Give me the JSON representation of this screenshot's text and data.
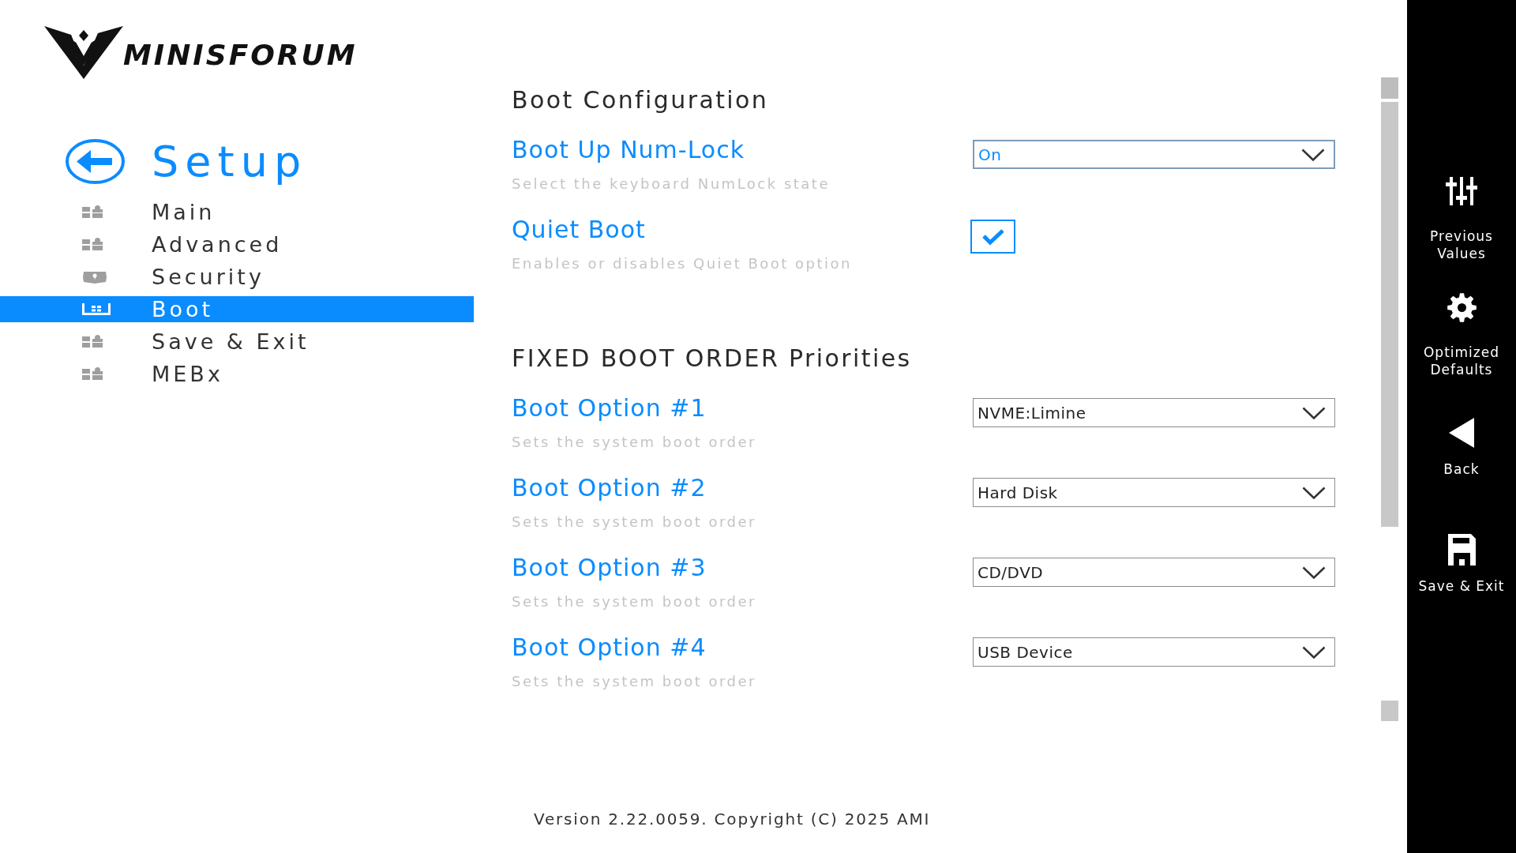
{
  "logo": {
    "text": "MINISFORUM"
  },
  "header": {
    "title": "Setup"
  },
  "sidebar": {
    "items": [
      {
        "label": "Main",
        "selected": false
      },
      {
        "label": "Advanced",
        "selected": false
      },
      {
        "label": "Security",
        "selected": false
      },
      {
        "label": "Boot",
        "selected": true
      },
      {
        "label": "Save & Exit",
        "selected": false
      },
      {
        "label": "MEBx",
        "selected": false
      }
    ]
  },
  "sections": [
    {
      "heading": "Boot Configuration",
      "rows": [
        {
          "kind": "dropdown",
          "label": "Boot Up Num-Lock",
          "description": "Select the keyboard NumLock state",
          "value": "On",
          "focused": true
        },
        {
          "kind": "checkbox",
          "label": "Quiet Boot",
          "description": "Enables or disables Quiet Boot option",
          "checked": true
        }
      ]
    },
    {
      "heading": "FIXED BOOT ORDER Priorities",
      "rows": [
        {
          "kind": "dropdown",
          "label": "Boot Option #1",
          "description": "Sets the system boot order",
          "value": "NVME:Limine",
          "focused": false
        },
        {
          "kind": "dropdown",
          "label": "Boot Option #2",
          "description": "Sets the system boot order",
          "value": "Hard Disk",
          "focused": false
        },
        {
          "kind": "dropdown",
          "label": "Boot Option #3",
          "description": "Sets the system boot order",
          "value": "CD/DVD",
          "focused": false
        },
        {
          "kind": "dropdown",
          "label": "Boot Option #4",
          "description": "Sets the system boot order",
          "value": "USB Device",
          "focused": false
        }
      ]
    }
  ],
  "actions": [
    {
      "label": "Previous Values"
    },
    {
      "label": "Optimized Defaults"
    },
    {
      "label": "Back"
    },
    {
      "label": "Save & Exit"
    }
  ],
  "footer": {
    "text": "Version 2.22.0059. Copyright (C) 2025 AMI"
  }
}
